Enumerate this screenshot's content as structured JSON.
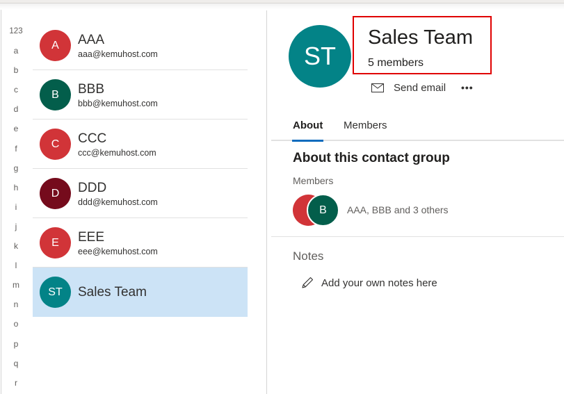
{
  "alphabet_index": [
    "123",
    "a",
    "b",
    "c",
    "d",
    "e",
    "f",
    "g",
    "h",
    "i",
    "j",
    "k",
    "l",
    "m",
    "n",
    "o",
    "p",
    "q",
    "r"
  ],
  "contacts": [
    {
      "initials": "A",
      "name": "AAA",
      "email": "aaa@kemuhost.com",
      "color": "#d13438"
    },
    {
      "initials": "B",
      "name": "BBB",
      "email": "bbb@kemuhost.com",
      "color": "#035e4b"
    },
    {
      "initials": "C",
      "name": "CCC",
      "email": "ccc@kemuhost.com",
      "color": "#d13438"
    },
    {
      "initials": "D",
      "name": "DDD",
      "email": "ddd@kemuhost.com",
      "color": "#750b1c"
    },
    {
      "initials": "E",
      "name": "EEE",
      "email": "eee@kemuhost.com",
      "color": "#d13438"
    },
    {
      "initials": "ST",
      "name": "Sales Team",
      "email": "",
      "color": "#038387",
      "selected": true
    }
  ],
  "detail": {
    "avatar_initials": "ST",
    "title": "Sales Team",
    "member_count": "5 members",
    "actions": {
      "send_email": "Send email",
      "more": "•••"
    },
    "tabs": [
      {
        "label": "About",
        "active": true
      },
      {
        "label": "Members",
        "active": false
      }
    ],
    "about": {
      "section_title": "About this contact group",
      "members_label": "Members",
      "member_avatar_initials": "B",
      "members_summary": "AAA, BBB and 3 others"
    },
    "notes": {
      "label": "Notes",
      "add_placeholder": "Add your own notes here"
    }
  },
  "colors": {
    "accent": "#0f6cbd",
    "selected_bg": "#cce3f6",
    "highlight_border": "#e00000"
  }
}
